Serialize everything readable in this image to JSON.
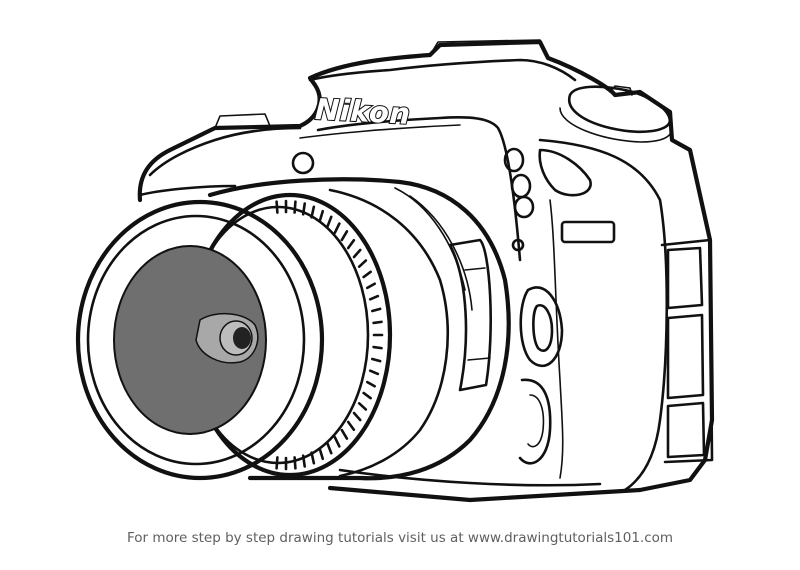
{
  "camera": {
    "brand_text": "Nikon"
  },
  "footer": {
    "caption": "For more step by step drawing tutorials visit us at www.drawingtutorials101.com"
  },
  "colors": {
    "line": "#111111",
    "lens_glass": "#6f6f6f",
    "lens_inner": "#a8a8a8",
    "caption": "#5f5f5f",
    "background": "#ffffff"
  }
}
